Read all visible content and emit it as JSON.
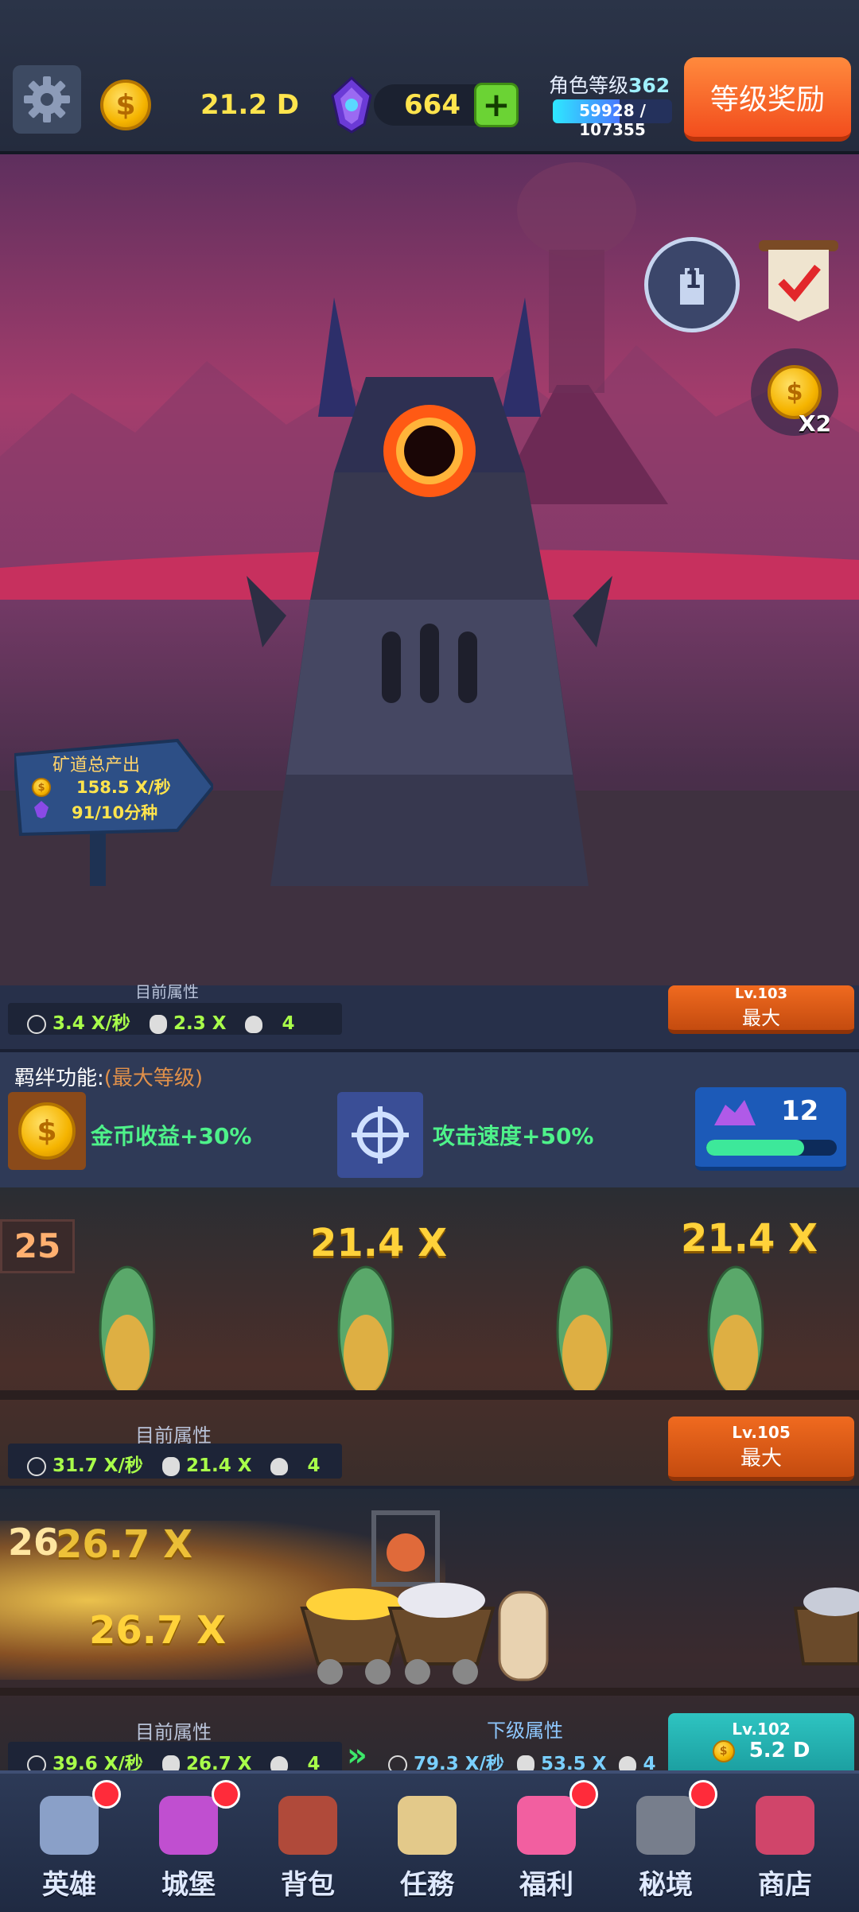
{
  "header": {
    "gold": "21.2 D",
    "gems": "664",
    "level_label": "角色等级",
    "level": "362",
    "exp_text": "59928 / 107355",
    "exp_fraction": 0.558,
    "reward_button": "等级奖励"
  },
  "scene": {
    "sign_title": "矿道总产出",
    "gold_rate": "158.5 X/秒",
    "gem_rate": "91/10分种",
    "double_label": "X2",
    "tower_level": "1"
  },
  "shaft_prev": {
    "stat_label": "目前属性",
    "rate": "3.4 X/秒",
    "carry": "2.3 X",
    "workers": "4",
    "lv": "Lv.103",
    "button": "最大"
  },
  "bond": {
    "title": "羁绊功能:",
    "max_text": "(最大等级)",
    "bonus1": "金币收益+30%",
    "bonus2": "攻击速度+50%",
    "gem_count": "12",
    "progress_fraction": 0.75
  },
  "shaft25": {
    "number": "25",
    "float1": "21.4 X",
    "float2": "21.4 X",
    "stat_label": "目前属性",
    "rate": "31.7 X/秒",
    "carry": "21.4 X",
    "workers": "4",
    "lv": "Lv.105",
    "button": "最大"
  },
  "shaft26": {
    "number": "26",
    "float1": "26.7 X",
    "float2": "26.7 X",
    "stat_label": "目前属性",
    "next_label": "下级属性",
    "rate": "39.6 X/秒",
    "carry": "26.7 X",
    "workers": "4",
    "next_rate": "79.3 X/秒",
    "next_carry": "53.5 X",
    "next_workers": "4",
    "lv": "Lv.102",
    "cost": "5.2 D"
  },
  "nav": [
    {
      "label": "英雄",
      "icon": "knight-helmet-icon",
      "badge": true,
      "color": "#8aa0c8"
    },
    {
      "label": "城堡",
      "icon": "castle-icon",
      "badge": true,
      "color": "#c04fd0"
    },
    {
      "label": "背包",
      "icon": "backpack-icon",
      "badge": false,
      "color": "#b04a3a"
    },
    {
      "label": "任務",
      "icon": "quest-scroll-icon",
      "badge": false,
      "color": "#e3c98a"
    },
    {
      "label": "福利",
      "icon": "prize-wheel-icon",
      "badge": true,
      "color": "#f25fa0"
    },
    {
      "label": "秘境",
      "icon": "skull-gate-icon",
      "badge": true,
      "color": "#777e8c"
    },
    {
      "label": "商店",
      "icon": "shop-stall-icon",
      "badge": false,
      "color": "#d0456a"
    }
  ]
}
